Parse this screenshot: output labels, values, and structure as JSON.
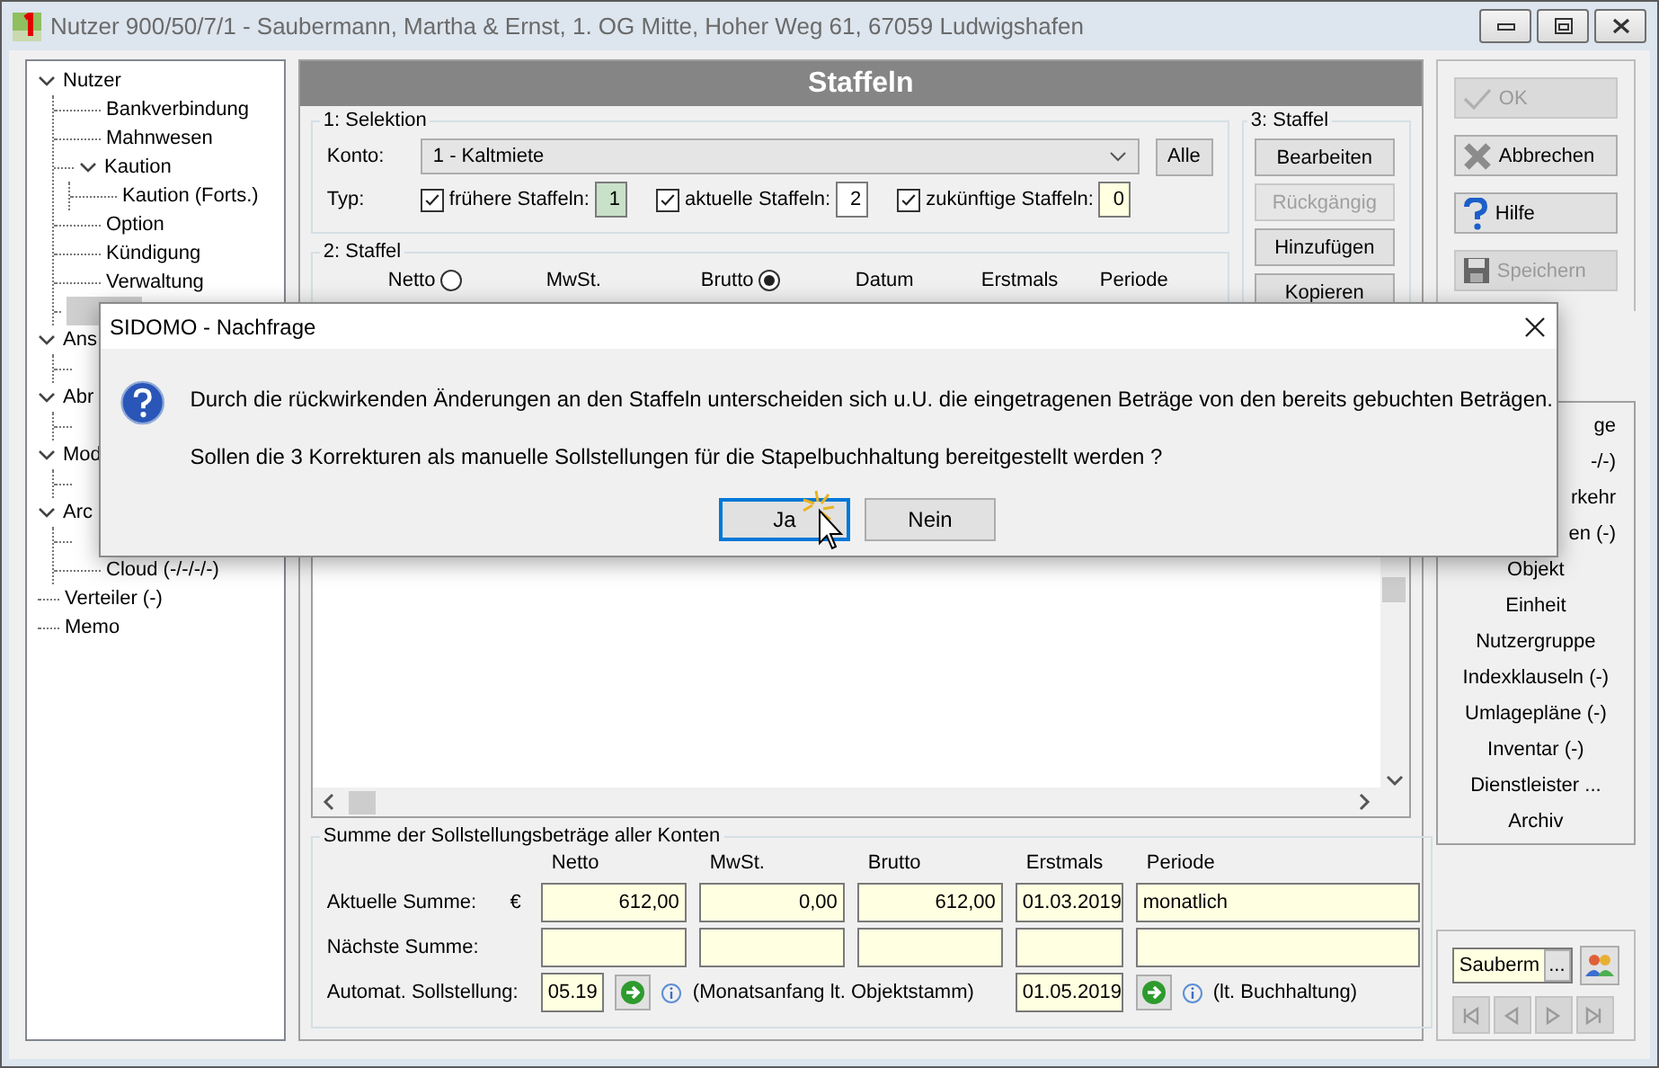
{
  "window": {
    "title": "Nutzer 900/50/7/1 - Saubermann, Martha & Ernst, 1. OG Mitte, Hoher Weg 61, 67059 Ludwigshafen"
  },
  "tree": [
    {
      "label": "Nutzer",
      "expanded": true,
      "children": [
        {
          "label": "Bankverbindung"
        },
        {
          "label": "Mahnwesen"
        },
        {
          "label": "Kaution",
          "expanded": true,
          "children": [
            {
              "label": "Kaution (Forts.)"
            }
          ]
        },
        {
          "label": "Option"
        },
        {
          "label": "Kündigung"
        },
        {
          "label": "Verwaltung"
        },
        {
          "selected": true
        }
      ]
    },
    {
      "label": "Ans",
      "expanded": true,
      "children": [
        {
          "selected": false
        }
      ]
    },
    {
      "label": "Abr",
      "expanded": true,
      "children": [
        {
          "selected": false
        }
      ]
    },
    {
      "label": "Mod",
      "expanded": true,
      "children": [
        {
          "selected": false
        }
      ]
    },
    {
      "label": "Arc",
      "expanded": true,
      "children": [
        {
          "selected": false
        },
        {
          "label": "Cloud (-/-/-/-)"
        }
      ]
    },
    {
      "label": "Verteiler (-)"
    },
    {
      "label": "Memo"
    }
  ],
  "panel": {
    "title": "Staffeln"
  },
  "selektion": {
    "title": "1: Selektion",
    "konto_label": "Konto:",
    "konto_value": "1 - Kaltmiete",
    "all_button": "Alle",
    "typ_label": "Typ:",
    "types": [
      {
        "label": "frühere Staffeln:",
        "checked": true,
        "count": "1",
        "color": "#c8e1c8"
      },
      {
        "label": "aktuelle Staffeln:",
        "checked": true,
        "count": "2",
        "color": "#ffffff"
      },
      {
        "label": "zukünftige Staffeln:",
        "checked": true,
        "count": "0",
        "color": "#ffffe1"
      }
    ]
  },
  "staffel_actions": {
    "title": "3: Staffel",
    "buttons": [
      {
        "label": "Bearbeiten",
        "disabled": false
      },
      {
        "label": "Rückgängig",
        "disabled": true
      },
      {
        "label": "Hinzufügen",
        "disabled": false
      },
      {
        "label": "Kopieren",
        "disabled": false
      }
    ]
  },
  "staffel": {
    "title": "2: Staffel",
    "columns": [
      {
        "label": "Netto",
        "kind": "radio",
        "selected": false
      },
      {
        "label": "MwSt.",
        "kind": "plain"
      },
      {
        "label": "Brutto",
        "kind": "radio",
        "selected": true
      },
      {
        "label": "Datum",
        "kind": "plain"
      },
      {
        "label": "Erstmals",
        "kind": "plain"
      },
      {
        "label": "Periode",
        "kind": "plain"
      }
    ]
  },
  "summary": {
    "title": "Summe der Sollstellungsbeträge aller Konten",
    "columns": [
      "Netto",
      "MwSt.",
      "Brutto",
      "Erstmals",
      "Periode"
    ],
    "rows": [
      {
        "kind": "values",
        "label": "Aktuelle Summe:",
        "currency": "€",
        "values": [
          "612,00",
          "0,00",
          "612,00",
          "01.03.2019",
          "monatlich"
        ]
      },
      {
        "kind": "empty",
        "label": "Nächste Summe:"
      },
      {
        "kind": "auto",
        "label": "Automat. Sollstellung:",
        "month": "05.19",
        "month_note": "(Monatsanfang lt. Objektstamm)",
        "date": "01.05.2019",
        "date_note": "(lt. Buchhaltung)"
      }
    ]
  },
  "actions": [
    {
      "label": "OK",
      "kind": "ok",
      "disabled": true
    },
    {
      "label": "Abbrechen",
      "kind": "cancel",
      "disabled": false
    },
    {
      "label": "Hilfe",
      "kind": "help",
      "disabled": false
    },
    {
      "label": "Speichern",
      "kind": "save",
      "disabled": true
    }
  ],
  "links": [
    {
      "label": "ge",
      "kind": "cut"
    },
    {
      "label": "-/-)",
      "kind": "cut"
    },
    {
      "label": "rkehr",
      "kind": "cut"
    },
    {
      "label": "en (-)",
      "kind": "cut"
    },
    {
      "label": "Objekt",
      "kind": "full"
    },
    {
      "label": "Einheit",
      "kind": "full"
    },
    {
      "label": "Nutzergruppe",
      "kind": "full"
    },
    {
      "label": "Indexklauseln (-)",
      "kind": "full"
    },
    {
      "label": "Umlagepläne (-)",
      "kind": "full"
    },
    {
      "label": "Inventar (-)",
      "kind": "full"
    },
    {
      "label": "Dienstleister ...",
      "kind": "full"
    },
    {
      "label": "Archiv",
      "kind": "full"
    }
  ],
  "navigator": {
    "value": "Sauberm",
    "browse_button": "...",
    "buttons": [
      {
        "kind": "first",
        "disabled": true
      },
      {
        "kind": "prev",
        "disabled": true
      },
      {
        "kind": "next",
        "disabled": true
      },
      {
        "kind": "last",
        "disabled": true
      }
    ]
  },
  "dialog": {
    "title": "SIDOMO - Nachfrage",
    "lines": [
      "Durch die rückwirkenden Änderungen an den Staffeln unterscheiden sich u.U. die eingetragenen Beträge von den bereits gebuchten Beträgen.",
      "Sollen die 3 Korrekturen als manuelle Sollstellungen für die Stapelbuchhaltung bereitgestellt werden ?"
    ],
    "buttons": [
      {
        "label": "Ja",
        "selected": true
      },
      {
        "label": "Nein",
        "selected": false
      }
    ]
  }
}
